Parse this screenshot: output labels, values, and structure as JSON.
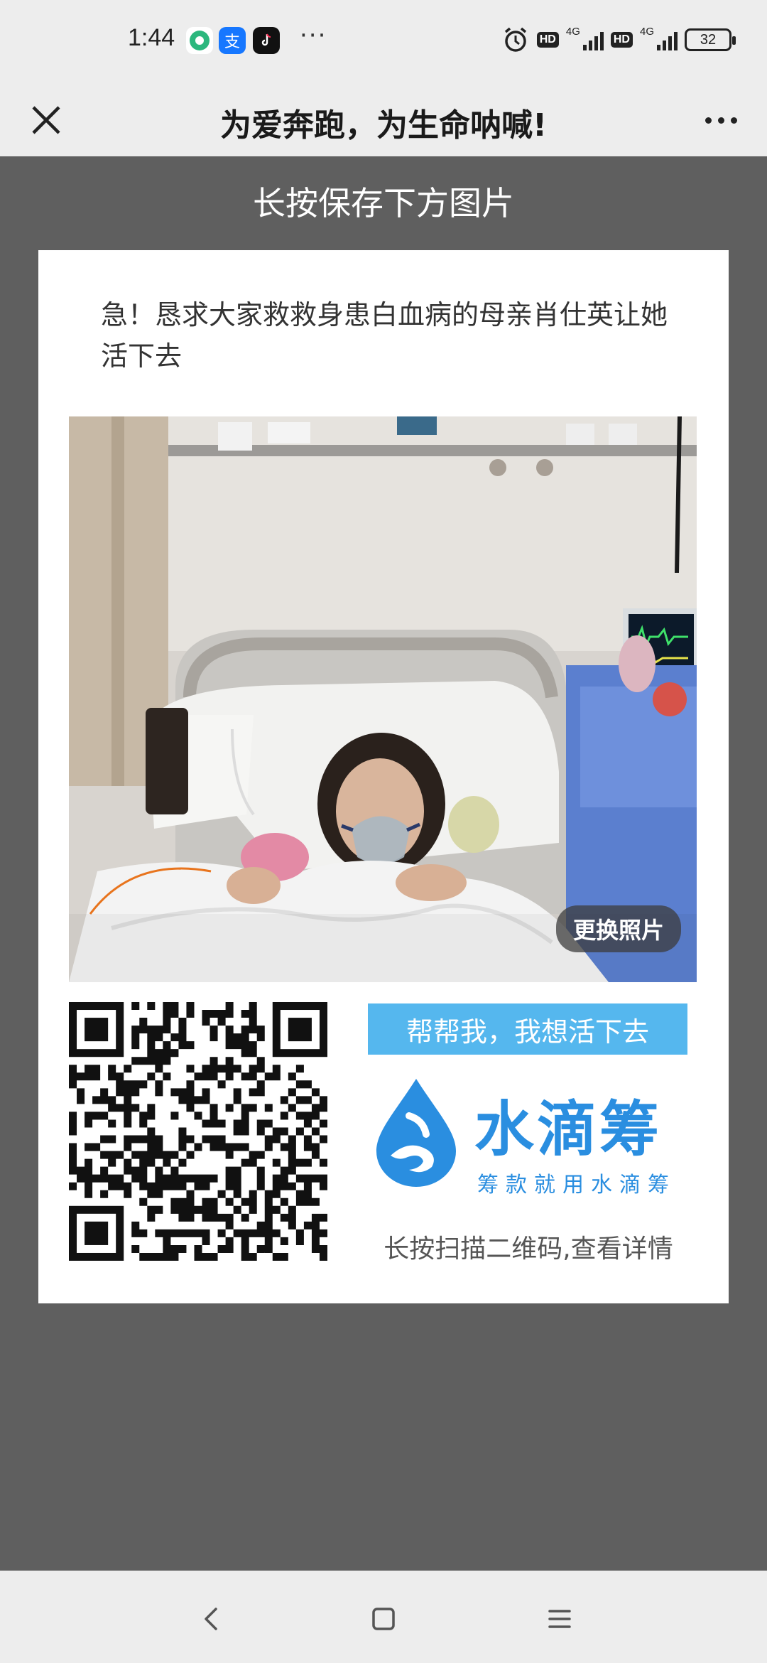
{
  "status_bar": {
    "time": "1:44",
    "more": "···",
    "hd1": "HD",
    "net1": "4G",
    "hd2": "HD",
    "net2": "4G",
    "battery": "32"
  },
  "nav": {
    "title": "为爱奔跑，为生命呐喊!"
  },
  "hint": "长按保存下方图片",
  "card": {
    "title": "急！恳求大家救救身患白血病的母亲肖仕英让她活下去",
    "change_photo": "更换照片",
    "slogan": "帮帮我，我想活下去",
    "brand": "水滴筹",
    "brand_sub": "筹款就用水滴筹",
    "scan_hint": "长按扫描二维码,查看详情"
  },
  "colors": {
    "accent": "#55b7ee",
    "brand": "#2a8ee0",
    "overlay": "#5f5f5f"
  }
}
